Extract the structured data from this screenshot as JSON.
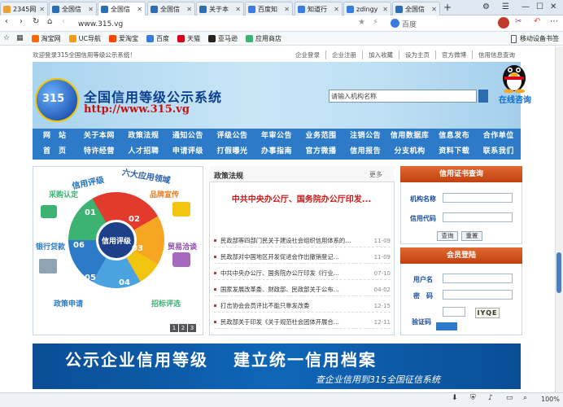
{
  "browser": {
    "tabs": [
      {
        "label": "2345网",
        "color": "#e8a23b",
        "active": false
      },
      {
        "label": "全国信",
        "color": "#2e6db0",
        "active": false
      },
      {
        "label": "全国信",
        "color": "#2e6db0",
        "active": true
      },
      {
        "label": "全国信",
        "color": "#2e6db0",
        "active": false
      },
      {
        "label": "关于本",
        "color": "#2e6db0",
        "active": false
      },
      {
        "label": "百度知",
        "color": "#3a7be0",
        "active": false
      },
      {
        "label": "知道行",
        "color": "#3a7be0",
        "active": false
      },
      {
        "label": "zdingy",
        "color": "#3a7be0",
        "active": false
      },
      {
        "label": "全国信",
        "color": "#2e6db0",
        "active": false
      }
    ],
    "new_tab": "+",
    "url": "www.315.vg",
    "search_engine": "百度",
    "bookmarks": [
      {
        "label": "淘宝网",
        "color": "#ff6a00"
      },
      {
        "label": "UC导航",
        "color": "#f39c12"
      },
      {
        "label": "爱淘宝",
        "color": "#ff4400"
      },
      {
        "label": "百度",
        "color": "#3a7be0"
      },
      {
        "label": "天猫",
        "color": "#d9001b"
      },
      {
        "label": "亚马逊",
        "color": "#222222"
      },
      {
        "label": "应用商店",
        "color": "#3cb371"
      }
    ],
    "mobile_bookmarks": "移动设备书签",
    "zoom": "100%"
  },
  "site": {
    "welcome": "欢迎登录315全国信用等级公示系统！",
    "top_links": [
      "企业登录",
      "企业注册",
      "加入收藏",
      "设为主页",
      "官方微博",
      "信用信息查询"
    ],
    "logo_text": "315",
    "name": "全国信用等级公示系统",
    "url": "http://www.315.vg",
    "search_placeholder": "请输入机构名称",
    "qq_label": "在线咨询",
    "nav_row1": [
      "网　站",
      "关于本网",
      "政策法规",
      "通知公告",
      "评级公告",
      "年审公告",
      "业务范围",
      "注销公告",
      "信用数据库",
      "信息发布",
      "合作单位"
    ],
    "nav_row2": [
      "首　页",
      "特许经营",
      "人才招聘",
      "申请评级",
      "打假曝光",
      "办事指南",
      "官方微播",
      "信用报告",
      "分支机构",
      "资料下载",
      "联系我们"
    ]
  },
  "slide": {
    "title_left": "信用评级",
    "title_right": "六大应用领域",
    "center": "信用评级",
    "numbers": [
      "01",
      "02",
      "03",
      "04",
      "05",
      "06"
    ],
    "labels": [
      "采购认定",
      "品牌宣传",
      "银行贷款",
      "贸易洽谈",
      "政策申请",
      "招标评选"
    ],
    "pages": [
      "1",
      "2",
      "3"
    ]
  },
  "news": {
    "title": "政策法规",
    "more": "更多",
    "headline": "中共中央办公厅、国务院办公厅印发...",
    "items": [
      {
        "text": "民政部等四部门民关于建设社会组织信用体系的…",
        "date": "11-09"
      },
      {
        "text": "民政部对中国地区开发促进会作出撤销登记…",
        "date": "11-09"
      },
      {
        "text": "中共中央办公厅、国务院办公厅印发《行业…",
        "date": "07-10"
      },
      {
        "text": "国家发展改革委、财政部、民政部关于公布…",
        "date": "04-02"
      },
      {
        "text": "打击协会会员评比不能只靠发改委",
        "date": "12-15"
      },
      {
        "text": "民政部关于印发《关于规范社会团体开展合…",
        "date": "12-11"
      }
    ]
  },
  "cert": {
    "title": "信用证书查询",
    "org_label": "机构名称",
    "code_label": "信用代码",
    "query_btn": "查询",
    "reset_btn": "重置"
  },
  "login": {
    "title": "会员登陆",
    "user_label": "用户名",
    "pwd_label": "密　码",
    "captcha_label": "验证码",
    "captcha": "IYQE"
  },
  "bottom_banner": {
    "line1": "公示企业信用等级　 建立统一信用档案",
    "line2": "查企业信用到315全国征信系统"
  }
}
